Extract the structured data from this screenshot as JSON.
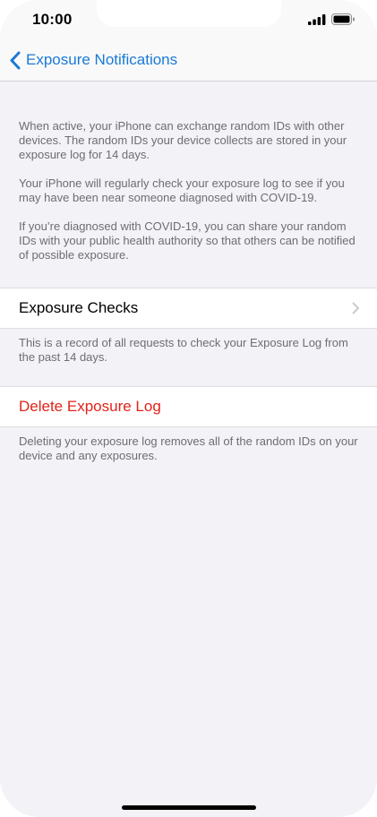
{
  "status_bar": {
    "time": "10:00"
  },
  "nav": {
    "back_label": "Exposure Notifications",
    "back_icon": "chevron-left-icon"
  },
  "intro": {
    "paragraphs": [
      "When active, your iPhone can exchange random IDs with other devices. The random IDs your device collects are stored in your exposure log for 14 days.",
      "Your iPhone will regularly check your exposure log to see if you may have been near someone diagnosed with COVID-19.",
      "If you’re diagnosed with COVID-19, you can share your random IDs with your public health authority so that others can be notified of possible exposure."
    ]
  },
  "exposure_checks": {
    "label": "Exposure Checks",
    "footer": "This is a record of all requests to check your Exposure Log from the past 14 days."
  },
  "delete_log": {
    "label": "Delete Exposure Log",
    "footer": "Deleting your exposure log removes all of the random IDs on your device and any exposures."
  },
  "colors": {
    "accent": "#1a7ad6",
    "destructive": "#e0231a",
    "background": "#f2f2f7"
  }
}
